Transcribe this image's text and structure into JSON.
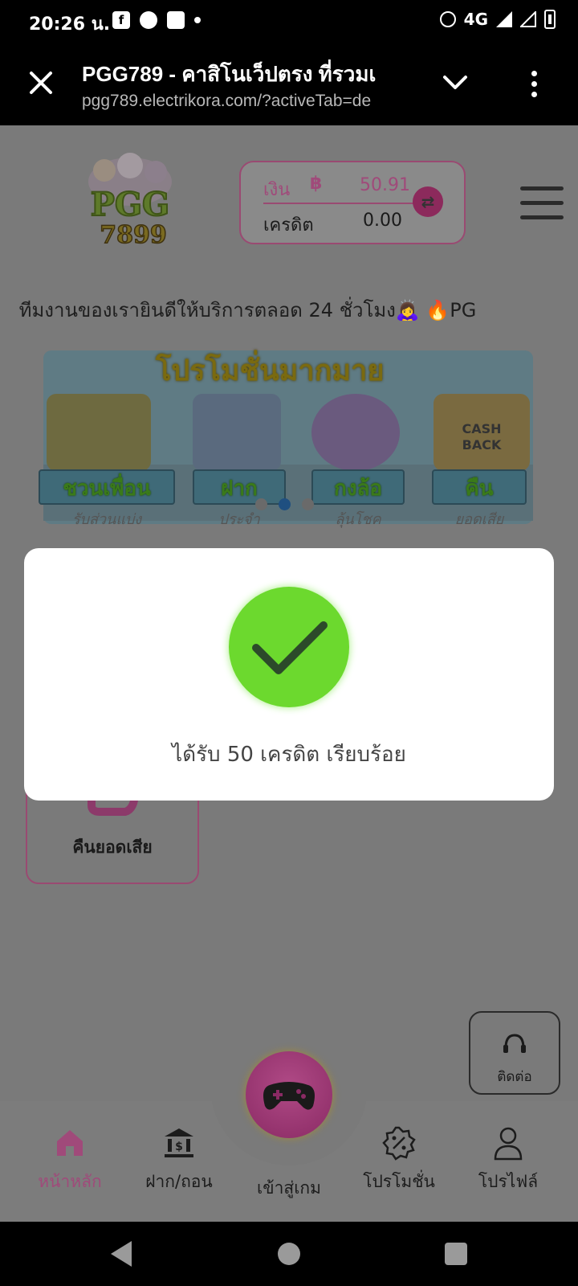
{
  "status_bar": {
    "time": "20:26 น.",
    "network": "4G"
  },
  "browser": {
    "page_title": "PGG789 - คาสิโนเว็ปตรง ที่รวมเ",
    "url": "pgg789.electrikora.com/?activeTab=de"
  },
  "header": {
    "logo_text": "PGG 7899",
    "wallet": {
      "money_label": "เงิน",
      "currency_symbol": "฿",
      "money_value": "50.91",
      "credit_label": "เครดิต",
      "credit_value": "0.00"
    }
  },
  "marquee_text": "ี ทีมงานของเรายินดีให้บริการตลอด 24 ชั่วโมง🙇‍♀️ 🔥PG",
  "promo_banner": {
    "title": "โปรโมชั่นมากมาย",
    "tiles": [
      {
        "label": "ชวนเพื่อน",
        "sub": "รับส่วนแบ่ง"
      },
      {
        "label": "ฝาก",
        "sub": "ประจำ"
      },
      {
        "label": "กงล้อ",
        "sub": "ลุ้นโชค"
      },
      {
        "label": "คืน",
        "sub": "ยอดเสีย"
      }
    ],
    "cashback_art_text": "CASH BACK",
    "active_slide": 2,
    "slide_count": 3
  },
  "cashback_card": {
    "label": "คืนยอดเสีย"
  },
  "modal": {
    "message": "ได้รับ 50 เครดิต เรียบร้อย"
  },
  "contact": {
    "label": "ติดต่อ"
  },
  "bottom_nav": {
    "home": "หน้าหลัก",
    "deposit_withdraw": "ฝาก/ถอน",
    "play_game": "เข้าสู่เกม",
    "promotions": "โปรโมชั่น",
    "profile": "โปรไฟล์"
  },
  "colors": {
    "accent_pink": "#a04a7a",
    "success_green": "#6cd92e",
    "overlay_gray": "#7a7a7a"
  }
}
